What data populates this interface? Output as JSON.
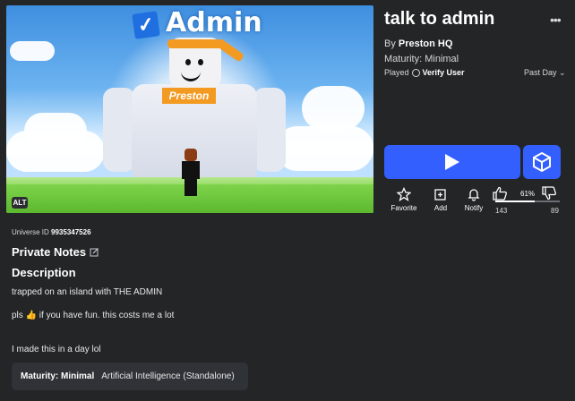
{
  "thumbnail": {
    "heading_text": "Admin",
    "shirt_text": "Preston",
    "alt_badge": "ALT"
  },
  "game": {
    "title": "talk to admin",
    "creator_prefix": "By",
    "creator_name": "Preston HQ",
    "maturity": "Maturity: Minimal",
    "played_label": "Played",
    "verify_user": "Verify User",
    "time_filter": "Past Day ⌄"
  },
  "actions": {
    "favorite": "Favorite",
    "add": "Add",
    "notify": "Notify"
  },
  "votes": {
    "up_count": "143",
    "down_count": "89",
    "percent": "61%",
    "ratio": 0.61
  },
  "details": {
    "universe_label": "Universe ID",
    "universe_id": "9935347526",
    "private_notes": "Private Notes",
    "description_title": "Description",
    "description_lines": [
      "trapped on an island with THE ADMIN",
      "pls 👍 if you have fun. this costs me a lot",
      "I made this in a day lol"
    ],
    "chip_label": "Maturity: Minimal",
    "chip_value": "Artificial Intelligence (Standalone)"
  },
  "colors": {
    "background": "#232527",
    "accent": "#335fff",
    "thumbnail_orange": "#f39a22"
  }
}
